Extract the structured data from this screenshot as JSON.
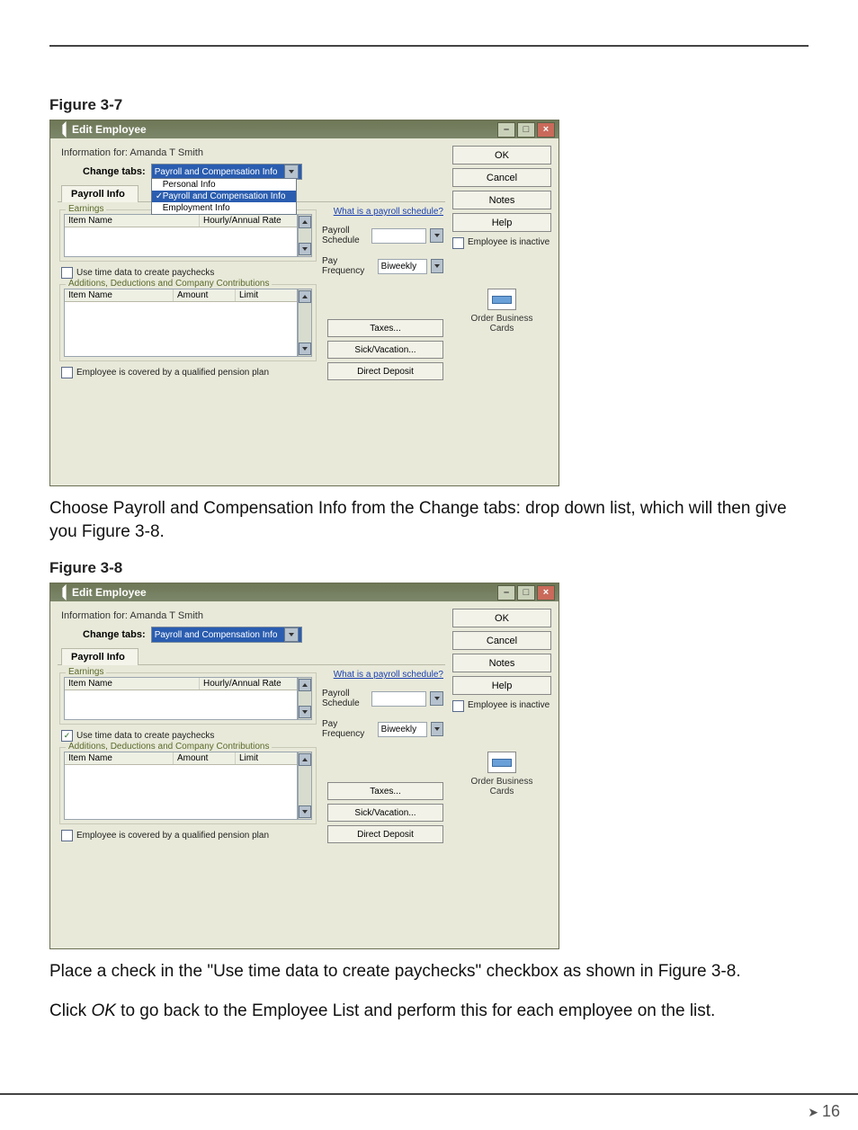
{
  "figures": {
    "f37": "Figure 3-7",
    "f38": "Figure 3-8"
  },
  "para1_a": "Choose Payroll and Compensation Info from the Change tabs: drop down list, which will then give you Figure 3-8.",
  "para2": "Place a check in the \"Use time data to create paychecks\" checkbox as shown in Figure 3-8.",
  "para3_a": "Click ",
  "para3_em": "OK",
  "para3_b": " to go back to the Employee List and perform this for each employee on the list.",
  "page_num": "16",
  "dlg": {
    "title": "Edit Employee",
    "info_for": "Information for: Amanda T Smith",
    "change_tabs_label": "Change tabs:",
    "change_tabs_value": "Payroll and Compensation Info",
    "dd_items": {
      "personal": "Personal Info",
      "payroll": "Payroll and Compensation Info",
      "employment": "Employment Info"
    },
    "tab_label": "Payroll Info",
    "earnings_legend": "Earnings",
    "col_item": "Item Name",
    "col_rate": "Hourly/Annual Rate",
    "use_time_label": "Use time data to create paychecks",
    "adc_legend": "Additions, Deductions and Company Contributions",
    "col_amount": "Amount",
    "col_limit": "Limit",
    "pension_label": "Employee is covered by a qualified pension plan",
    "sched_link": "What is a payroll schedule?",
    "sched_lbl1": "Payroll",
    "sched_lbl2": "Schedule",
    "payfreq_lbl": "Pay Frequency",
    "payfreq_val": "Biweekly",
    "btns": {
      "taxes": "Taxes...",
      "sickvac": "Sick/Vacation...",
      "dd": "Direct Deposit"
    },
    "side": {
      "ok": "OK",
      "cancel": "Cancel",
      "notes": "Notes",
      "help": "Help",
      "inactive": "Employee is inactive",
      "order1": "Order Business",
      "order2": "Cards"
    }
  }
}
